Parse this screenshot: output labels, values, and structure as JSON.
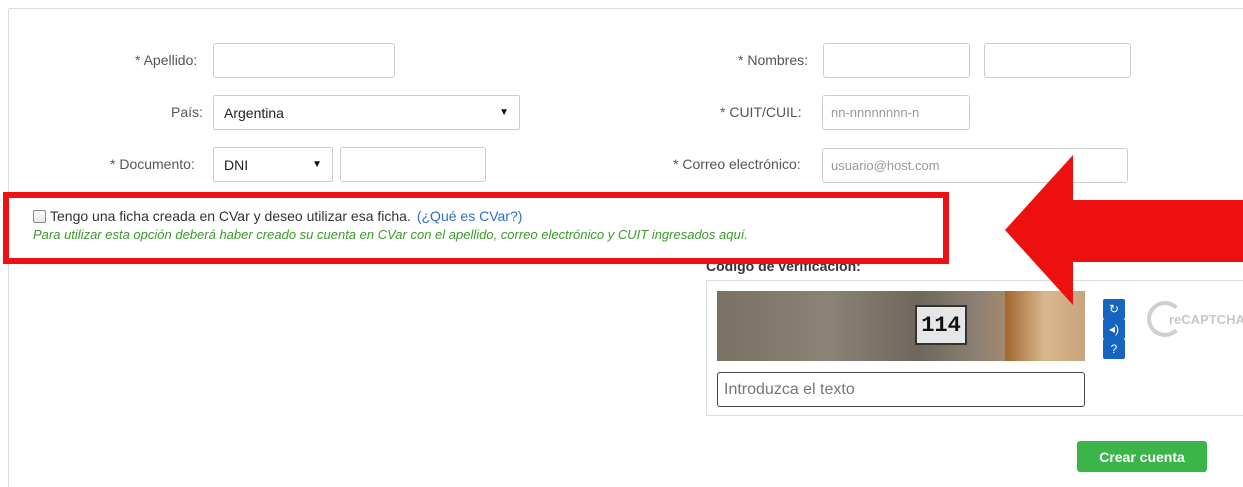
{
  "form": {
    "apellido_label": "* Apellido:",
    "nombres_label": "* Nombres:",
    "pais_label": "País:",
    "pais_value": "Argentina",
    "cuit_label": "* CUIT/CUIL:",
    "cuit_placeholder": "nn-nnnnnnnn-n",
    "documento_label": "* Documento:",
    "documento_type": "DNI",
    "correo_label": "* Correo electrónico:",
    "correo_placeholder": "usuario@host.com"
  },
  "cvar": {
    "checkbox_label": "Tengo una ficha creada en CVar y deseo utilizar esa ficha.",
    "link_text": "(¿Qué es CVar?)",
    "help_text": "Para utilizar esta opción deberá haber creado su cuenta en CVar con el apellido, correo electrónico y CUIT ingresados aquí."
  },
  "captcha": {
    "label": "Código de verificación:",
    "image_text": "114",
    "input_placeholder": "Introduzca el texto",
    "logo_text": "reCAPTCHA™"
  },
  "actions": {
    "create_label": "Crear cuenta"
  },
  "colors": {
    "highlight": "#ee1111",
    "primary_button": "#3bb44a",
    "link": "#2a6fc9",
    "help_text": "#3a9a2a"
  },
  "icons": {
    "refresh": "refresh-icon",
    "audio": "audio-icon",
    "help": "help-icon",
    "arrow": "arrow-left-icon"
  }
}
